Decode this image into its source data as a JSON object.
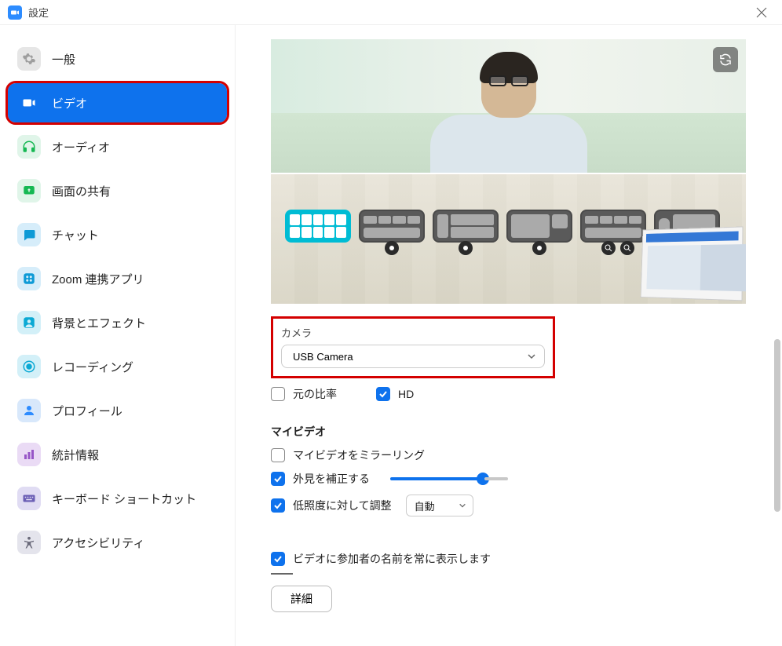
{
  "window": {
    "title": "設定"
  },
  "sidebar": {
    "items": [
      {
        "label": "一般",
        "icon": "gear"
      },
      {
        "label": "ビデオ",
        "icon": "video",
        "active": true
      },
      {
        "label": "オーディオ",
        "icon": "audio"
      },
      {
        "label": "画面の共有",
        "icon": "share"
      },
      {
        "label": "チャット",
        "icon": "chat"
      },
      {
        "label": "Zoom 連携アプリ",
        "icon": "apps"
      },
      {
        "label": "背景とエフェクト",
        "icon": "bg"
      },
      {
        "label": "レコーディング",
        "icon": "rec"
      },
      {
        "label": "プロフィール",
        "icon": "profile"
      },
      {
        "label": "統計情報",
        "icon": "stats"
      },
      {
        "label": "キーボード ショートカット",
        "icon": "keyboard"
      },
      {
        "label": "アクセシビリティ",
        "icon": "access"
      }
    ]
  },
  "camera": {
    "section_label": "カメラ",
    "selected": "USB Camera",
    "original_ratio_label": "元の比率",
    "original_ratio_checked": false,
    "hd_label": "HD",
    "hd_checked": true
  },
  "my_video": {
    "heading": "マイビデオ",
    "mirror_label": "マイビデオをミラーリング",
    "mirror_checked": false,
    "touchup_label": "外見を補正する",
    "touchup_checked": true,
    "touchup_slider": 80,
    "lowlight_label": "低照度に対して調整",
    "lowlight_checked": true,
    "lowlight_mode": "自動"
  },
  "names": {
    "always_show_label": "ビデオに参加者の名前を常に表示します",
    "always_show_checked": true
  },
  "advanced_button": "詳細",
  "colors": {
    "accent": "#0e72ed",
    "highlight": "#d40000"
  }
}
